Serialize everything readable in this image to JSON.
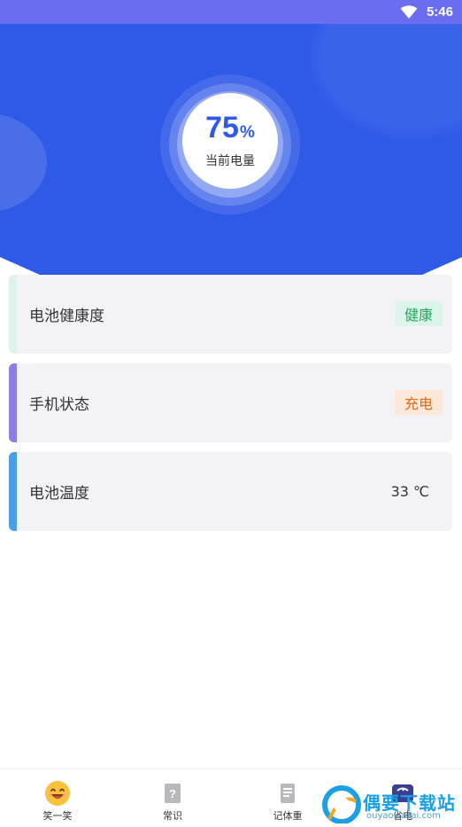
{
  "status_bar": {
    "time": "5:46",
    "wifi_icon": "wifi-icon"
  },
  "battery": {
    "percent": "75",
    "unit": "%",
    "label": "当前电量"
  },
  "cards": [
    {
      "title": "电池健康度",
      "badge": "健康",
      "accent_color": "#dff3ee",
      "badge_bg": "#dcf5ea",
      "badge_color": "#23a55a"
    },
    {
      "title": "手机状态",
      "badge": "充电",
      "accent_color": "#8e7cde",
      "badge_bg": "#fde7d8",
      "badge_color": "#e06a1b"
    },
    {
      "title": "电池温度",
      "value": "33 ℃",
      "accent_color": "#4a9ee8"
    }
  ],
  "tabs": [
    {
      "label": "笑一笑",
      "icon": "laughing-face-icon"
    },
    {
      "label": "常识",
      "icon": "question-card-icon"
    },
    {
      "label": "记体重",
      "icon": "document-icon"
    },
    {
      "label": "省电",
      "icon": "scale-icon"
    }
  ],
  "watermark": {
    "text_cn": "偶要下载站",
    "text_en": "ouyaoxiazai.com"
  },
  "colors": {
    "hero": "#2f5ae8",
    "status_bar": "#6a6df0",
    "card_bg": "#f2f2f7"
  }
}
